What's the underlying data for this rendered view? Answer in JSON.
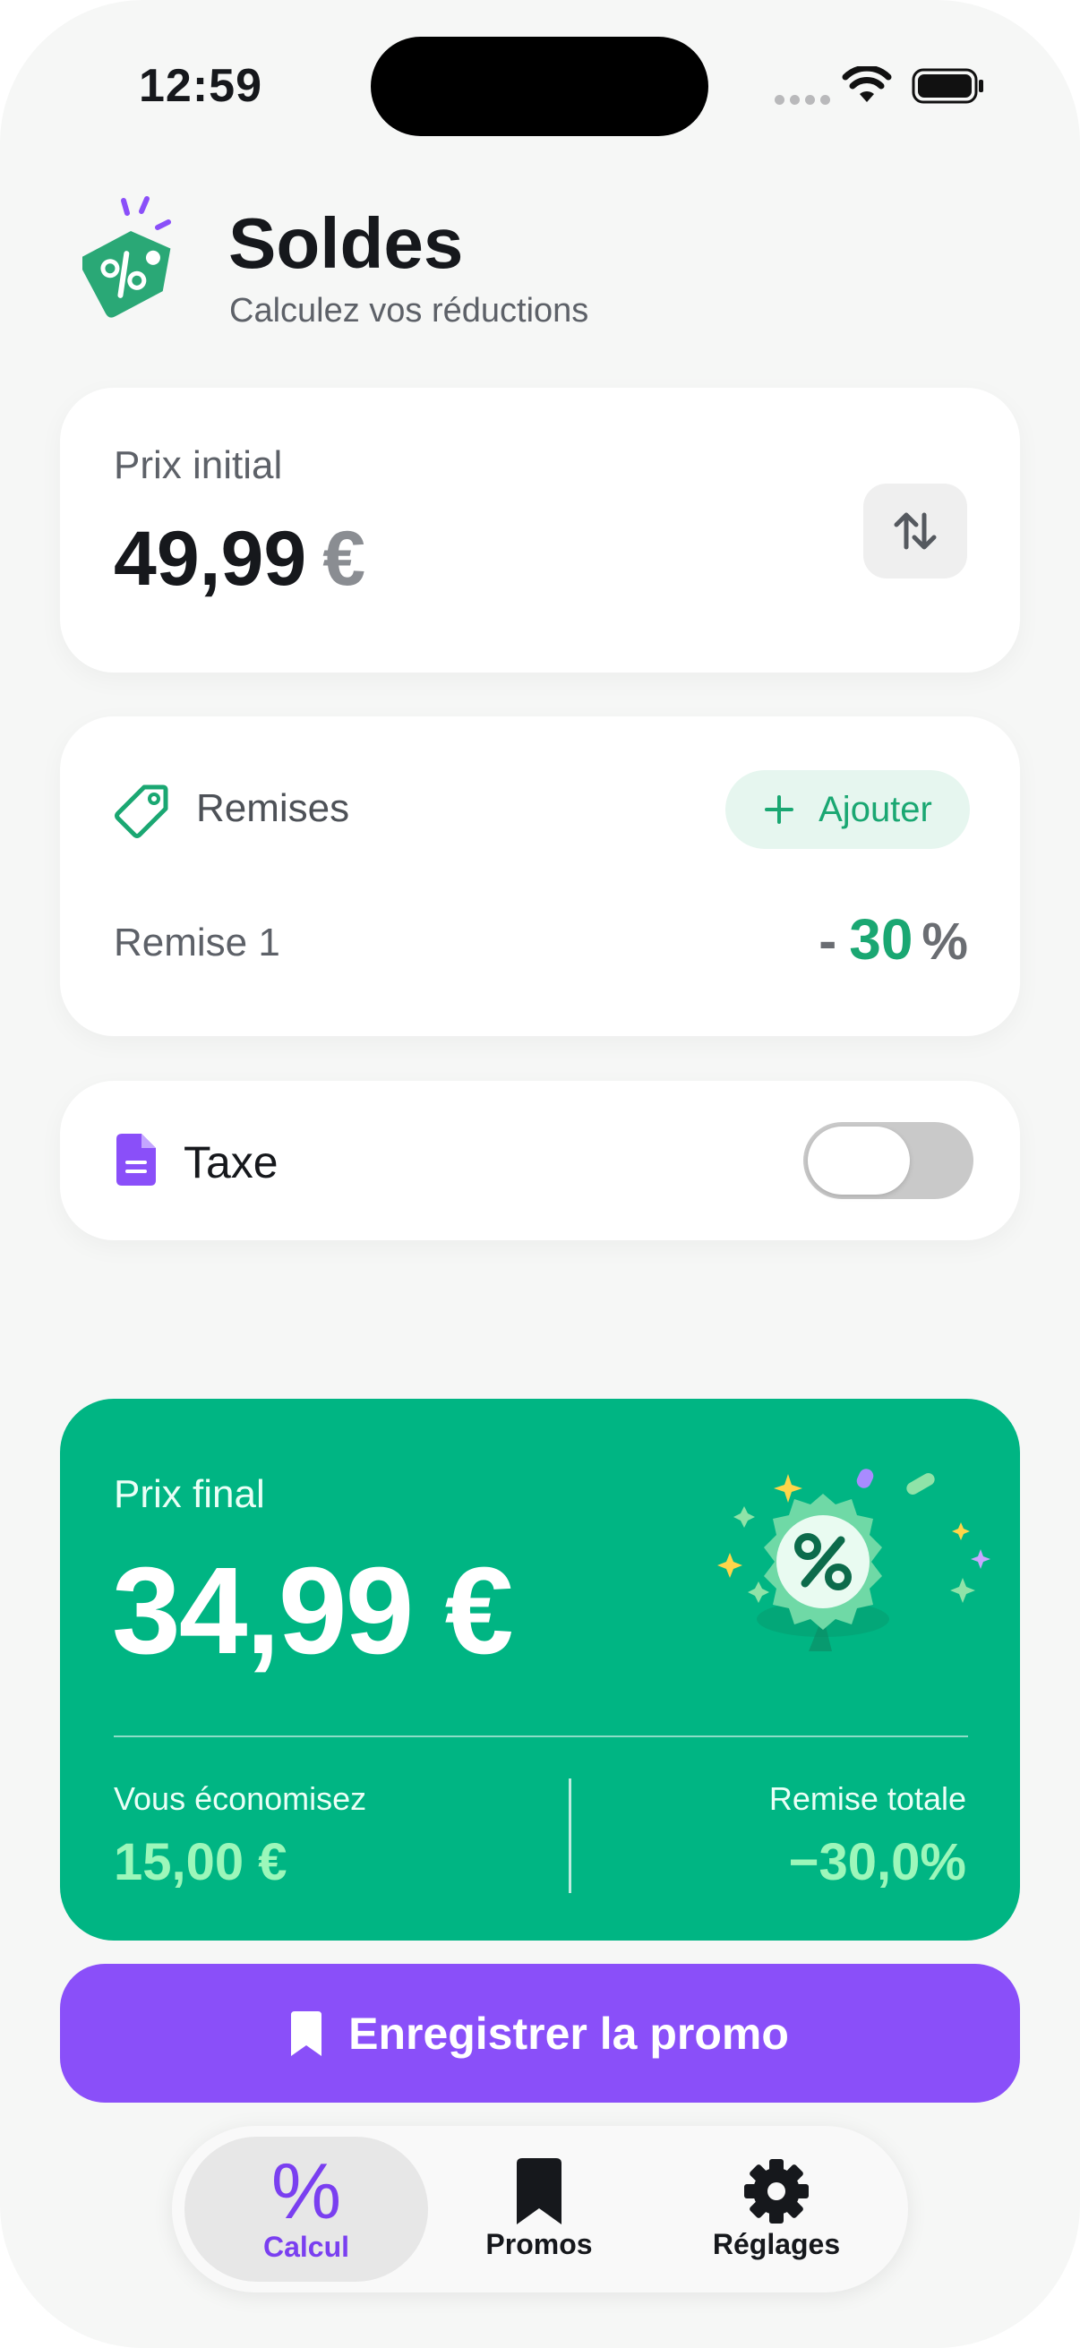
{
  "status_bar": {
    "time": "12:59"
  },
  "header": {
    "title": "Soldes",
    "subtitle": "Calculez vos réductions",
    "logo_icon": "percent-price-tag-icon"
  },
  "price_card": {
    "label": "Prix initial",
    "value": "49,99",
    "currency": "€",
    "swap_icon": "swap-vertical-icon"
  },
  "discounts_card": {
    "label": "Remises",
    "add_label": "Ajouter",
    "items": [
      {
        "label": "Remise 1",
        "sign": "-",
        "value": "30",
        "unit": "%"
      }
    ]
  },
  "tax_card": {
    "label": "Taxe",
    "enabled": false
  },
  "result": {
    "final_label": "Prix final",
    "final_value": "34,99 €",
    "savings_label": "Vous économisez",
    "savings_value": "15,00 €",
    "total_label": "Remise totale",
    "total_value": "−30,0%"
  },
  "save_button": {
    "label": "Enregistrer la promo",
    "icon": "bookmark-icon"
  },
  "tabbar": {
    "tabs": [
      {
        "label": "Calcul",
        "glyph": "%",
        "icon": "percent-icon",
        "active": true
      },
      {
        "label": "Promos",
        "icon": "bookmark-icon",
        "active": false
      },
      {
        "label": "Réglages",
        "icon": "gear-icon",
        "active": false
      }
    ]
  },
  "colors": {
    "accent_green": "#00b583",
    "accent_purple": "#8a4ff9",
    "highlight_green": "#9cf7ba"
  }
}
